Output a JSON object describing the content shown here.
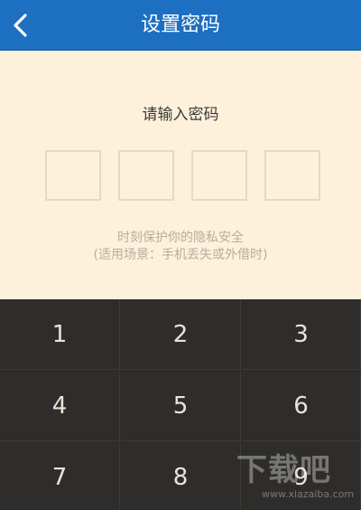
{
  "header": {
    "title": "设置密码",
    "back_icon": "chevron-left-icon"
  },
  "main": {
    "prompt": "请输入密码",
    "pin_length": 4,
    "hint_line1": "时刻保护你的隐私安全",
    "hint_line2": "(适用场景：手机丢失或外借时)"
  },
  "keypad": {
    "keys": [
      "1",
      "2",
      "3",
      "4",
      "5",
      "6",
      "7",
      "8",
      "9"
    ]
  },
  "watermark": {
    "main": "下载吧",
    "sub": "www.xiazaiba.com"
  },
  "colors": {
    "header_bg": "#1d6fc1",
    "content_bg": "#fdf1dc",
    "pin_border": "#e8d8bf",
    "keypad_bg": "#2e2d2b",
    "key_text": "#e9e4db"
  }
}
